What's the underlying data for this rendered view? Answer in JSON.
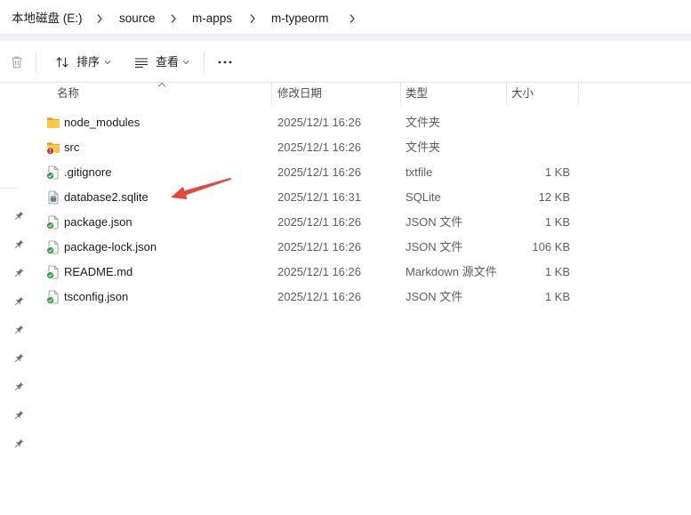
{
  "address_bar": {
    "items": [
      "本地磁盘 (E:)",
      "source",
      "m-apps",
      "m-typeorm"
    ],
    "separator_icon": "chevron-right-icon"
  },
  "toolbar": {
    "delete_icon": "trash-icon",
    "sort": {
      "label": "排序",
      "icon": "sort-icon",
      "dropdown_icon": "chevron-down-icon"
    },
    "view": {
      "label": "查看",
      "icon": "view-icon",
      "dropdown_icon": "chevron-down-icon"
    },
    "more_icon": "more-icon"
  },
  "nav_pane": {
    "item_icon": "pin-icon"
  },
  "columns": [
    {
      "label": "名称",
      "sort_icon": "chevron-up-icon"
    },
    {
      "label": "修改日期"
    },
    {
      "label": "类型"
    },
    {
      "label": "大小"
    }
  ],
  "files": [
    {
      "name": "node_modules",
      "modified": "2025/12/1 16:26",
      "type": "文件夹",
      "icon": "folder-icon"
    },
    {
      "name": "src",
      "modified": "2025/12/1 16:26",
      "type": "文件夹",
      "icon": "folder-error-icon"
    },
    {
      "name": ".gitignore",
      "modified": "2025/12/1 16:26",
      "type": "txtfile",
      "size": "1 KB",
      "icon": "file-check-icon"
    },
    {
      "name": "database2.sqlite",
      "modified": "2025/12/1 16:31",
      "type": "SQLite",
      "size": "12 KB",
      "icon": "database-file-icon"
    },
    {
      "name": "package.json",
      "modified": "2025/12/1 16:26",
      "type": "JSON 文件",
      "size": "1 KB",
      "icon": "file-check-icon"
    },
    {
      "name": "package-lock.json",
      "modified": "2025/12/1 16:26",
      "type": "JSON 文件",
      "size": "106 KB",
      "icon": "file-check-icon"
    },
    {
      "name": "README.md",
      "modified": "2025/12/1 16:26",
      "type": "Markdown 源文件",
      "size": "1 KB",
      "icon": "file-check-icon"
    },
    {
      "name": "tsconfig.json",
      "modified": "2025/12/1 16:26",
      "type": "JSON 文件",
      "size": "1 KB",
      "icon": "file-check-icon"
    }
  ],
  "colors": {
    "annotation_arrow": "#e5483b",
    "folder": "#ffc93c",
    "folder_back": "#e3a12b",
    "error_badge": "#d13438",
    "check_badge": "#2f9e44"
  }
}
